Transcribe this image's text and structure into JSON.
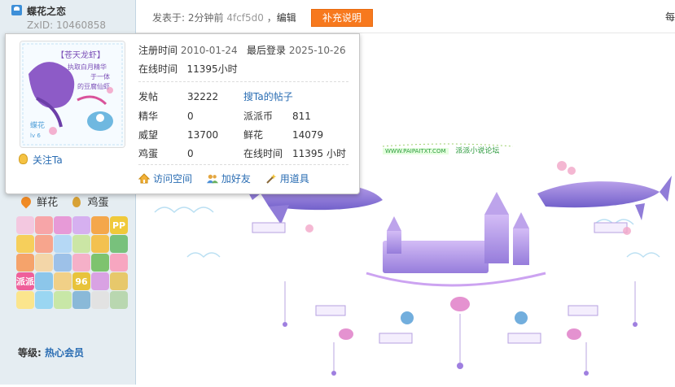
{
  "user": {
    "name": "蝶花之恋",
    "zxid": "ZxID:  10460858"
  },
  "post": {
    "meta_prefix": "发表于: ",
    "posted_time": "2分钟前",
    "hash": "4fcf5d0",
    "sep": "，",
    "edit_label": "编辑",
    "supplement_label": "补充说明",
    "floor_label": "每"
  },
  "card": {
    "avatar_text": {
      "line1": "【苍天龙虾】",
      "line2": "执取白月精华",
      "line3": "于一体",
      "line4": "的豆腐仙虾",
      "corner1": "蝶花",
      "corner2": "lv 6"
    },
    "register_label": "注册时间",
    "register_value": "2010-01-24",
    "lastlogin_label": "最后登录",
    "lastlogin_value": "2025-10-26",
    "online_label": "在线时间",
    "online_value": "11395小时",
    "stats": [
      {
        "k": "发帖",
        "v": "32222"
      },
      {
        "k": "精华",
        "v": "0"
      },
      {
        "k": "威望",
        "v": "13700"
      },
      {
        "k": "鸡蛋",
        "v": "0"
      }
    ],
    "search_posts": "搜Ta的帖子",
    "stats_right": [
      {
        "k": "派派币",
        "v": "811"
      },
      {
        "k": "鲜花",
        "v": "14079"
      },
      {
        "k": "在线时间",
        "v": "11395 小时"
      }
    ],
    "follow_label": "关注Ta",
    "actions": {
      "visit": "访问空间",
      "add_friend": "加好友",
      "use_item": "用道具"
    }
  },
  "sidebar": {
    "flower_label": "鲜花",
    "egg_label": "鸡蛋",
    "level_prefix": "等级: ",
    "level_value": "热心会员",
    "medal_labels": [
      "",
      "",
      "",
      "",
      "",
      "PP",
      "",
      "",
      "",
      "",
      "",
      "",
      "",
      "",
      "",
      "",
      "",
      "",
      "派派",
      "",
      "",
      "96",
      "",
      "",
      "",
      "",
      "",
      "",
      "",
      ""
    ],
    "medal_colors": [
      "#f3c8e0",
      "#f7a5a8",
      "#e79ad7",
      "#d6b0f0",
      "#f4a74b",
      "#f0c93a",
      "#f6cf5b",
      "#f7a58d",
      "#b5d8f5",
      "#cbe6a5",
      "#f3c14f",
      "#78c17c",
      "#f5a36b",
      "#f3d6a8",
      "#9dc1e8",
      "#f5b0c8",
      "#7ec36e",
      "#f7a6c0",
      "#ef5f9a",
      "#8cc6ea",
      "#f1d087",
      "#e8c33b",
      "#d9a2e3",
      "#e7c86b",
      "#fbe58d",
      "#9ad6f2",
      "#c8e7a7",
      "#8ab9d8",
      "#e2e2e2",
      "#b9d7b0"
    ]
  },
  "signature": {
    "url": "WWW.PAIPAITXT.COM",
    "forum": "派派小说论坛"
  },
  "colors": {
    "link": "#2a6db3",
    "accent_button": "#f7791e",
    "sidebar_bg": "#e5edf2"
  }
}
